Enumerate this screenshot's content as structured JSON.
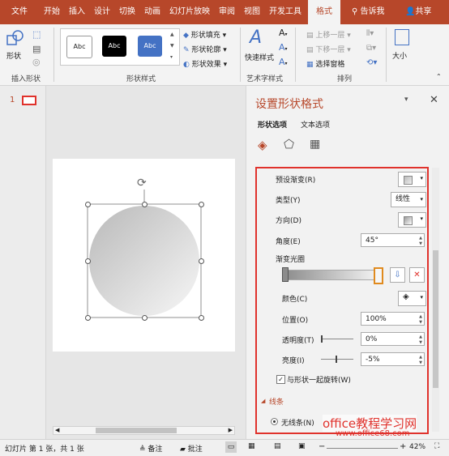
{
  "tabs": [
    "文件",
    "开始",
    "插入",
    "设计",
    "切换",
    "动画",
    "幻灯片放映",
    "审阅",
    "视图",
    "开发工具",
    "格式"
  ],
  "tell_me": "告诉我",
  "share": "共享",
  "ribbon": {
    "insert_shapes": {
      "label": "插入形状",
      "shape_btn": "形状"
    },
    "shape_styles": {
      "label": "形状样式",
      "sample": "Abc",
      "fill": "形状填充",
      "outline": "形状轮廓",
      "effect": "形状效果"
    },
    "wordart": {
      "label": "艺术字样式",
      "quick": "快速样式"
    },
    "arrange": {
      "label": "排列",
      "up": "上移一层",
      "down": "下移一层",
      "pane": "选择窗格"
    },
    "size": {
      "label": "大小"
    }
  },
  "slide_number": "1",
  "pane": {
    "title": "设置形状格式",
    "tab_shape": "形状选项",
    "tab_text": "文本选项",
    "preset": "预设渐变(R)",
    "type_label": "类型(Y)",
    "type_value": "线性",
    "direction": "方向(D)",
    "angle_label": "角度(E)",
    "angle_value": "45°",
    "stops_label": "渐变光圈",
    "color": "颜色(C)",
    "position_label": "位置(O)",
    "position_value": "100%",
    "transparency_label": "透明度(T)",
    "transparency_value": "0%",
    "brightness_label": "亮度(I)",
    "brightness_value": "-5%",
    "rotate_with_shape": "与形状一起旋转(W)",
    "line_section": "线条",
    "no_line": "无线条(N)"
  },
  "watermark": {
    "title": "office教程学习网",
    "url": "www.office68.com"
  },
  "status": {
    "slide_info": "幻灯片 第 1 张，共 1 张",
    "notes": "备注",
    "comments": "批注",
    "zoom": "42%"
  },
  "colors": {
    "accent": "#b7472a",
    "highlight": "#e0322c",
    "style_blue": "#4472c4"
  }
}
